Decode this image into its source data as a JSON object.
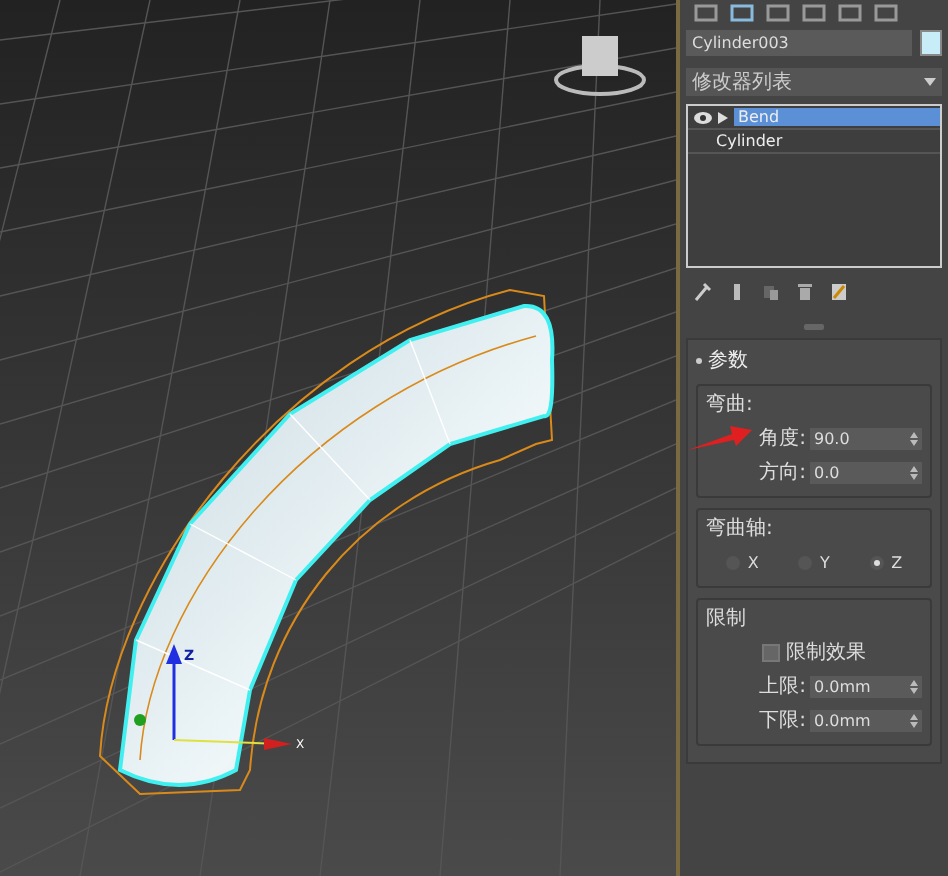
{
  "viewport": {
    "axis_labels": [
      "Z",
      "X"
    ]
  },
  "command_panel": {
    "object_name": "Cylinder003",
    "modifier_list": "修改器列表",
    "stack": [
      {
        "label": "Bend",
        "kind": "modifier",
        "selected": true
      },
      {
        "label": "Cylinder",
        "kind": "base",
        "selected": false
      }
    ],
    "rollout": {
      "title": "参数",
      "bend": {
        "title": "弯曲:",
        "fields": [
          {
            "label": "角度:",
            "value": "90.0"
          },
          {
            "label": "方向:",
            "value": "0.0"
          }
        ]
      },
      "axis": {
        "title": "弯曲轴:",
        "options": [
          {
            "label": "X",
            "selected": false
          },
          {
            "label": "Y",
            "selected": false
          },
          {
            "label": "Z",
            "selected": true
          }
        ]
      },
      "limits": {
        "title": "限制",
        "checkbox": {
          "label": "限制效果",
          "checked": false
        },
        "fields": [
          {
            "label": "上限:",
            "value": "0.0mm"
          },
          {
            "label": "下限:",
            "value": "0.0mm"
          }
        ]
      }
    }
  }
}
